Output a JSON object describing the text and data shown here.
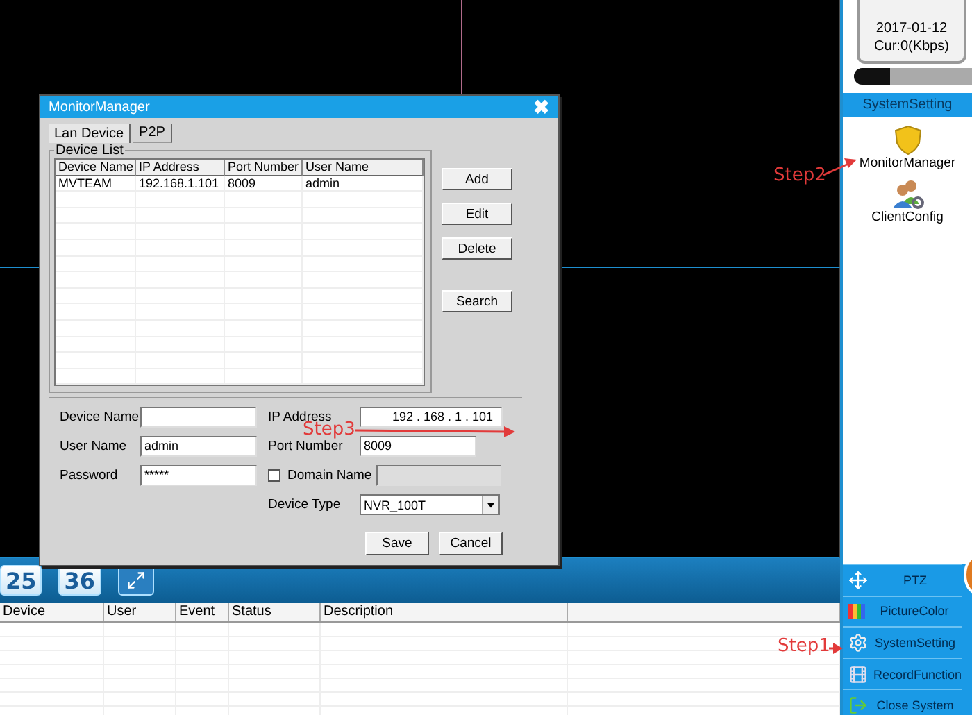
{
  "dialog": {
    "title": "MonitorManager",
    "close": "✖",
    "tabs": [
      {
        "label": "Lan Device",
        "selected": true
      },
      {
        "label": "P2P",
        "selected": false
      }
    ],
    "device_list": {
      "label": "Device List",
      "columns": [
        "Device Name",
        "IP Address",
        "Port Number",
        "User Name"
      ],
      "rows": [
        [
          "MVTEAM",
          "192.168.1.101",
          "8009",
          "admin"
        ]
      ]
    },
    "side_buttons": [
      "Add",
      "Edit",
      "Delete",
      "Search"
    ],
    "left_fields": [
      {
        "label": "Device Name",
        "kind": "text"
      },
      {
        "label": "User Name",
        "kind": "text",
        "value": "admin"
      },
      {
        "label": "Password",
        "kind": "text",
        "value": "*****"
      }
    ],
    "right_fields": [
      {
        "label": "IP Address",
        "kind": "ip",
        "value": "192 . 168 . 1 . 101"
      },
      {
        "label": "Port Number",
        "kind": "text",
        "value": "8009"
      },
      {
        "label": "Domain Name",
        "kind": "checkbox",
        "checked": false
      },
      {
        "label": "Device Type",
        "kind": "select",
        "value": "NVR_100T"
      }
    ],
    "footer_buttons": [
      "Save",
      "Cancel"
    ]
  },
  "layout_buttons": [
    "25",
    "36"
  ],
  "event_table": {
    "columns": [
      "Device",
      "User",
      "Event",
      "Status",
      "Description"
    ]
  },
  "status_box": {
    "lines": [
      "2017-01-12",
      "Cur:0(Kbps)"
    ],
    "level": 0.3
  },
  "system_setting": {
    "header": "SystemSetting",
    "items": [
      {
        "label": "MonitorManager",
        "kind": "shield"
      },
      {
        "label": "ClientConfig",
        "kind": "users"
      }
    ]
  },
  "menu": [
    {
      "label": "PTZ",
      "kind": "move"
    },
    {
      "label": "PictureColor",
      "kind": "color"
    },
    {
      "label": "SystemSetting",
      "kind": "gear"
    },
    {
      "label": "RecordFunction",
      "kind": "film"
    },
    {
      "label": "Close System",
      "kind": "exit"
    }
  ],
  "annotations": [
    {
      "label": "Step2",
      "kind": "step2"
    },
    {
      "label": "Step3",
      "kind": "step3"
    },
    {
      "label": "Step1",
      "kind": "step1"
    }
  ]
}
